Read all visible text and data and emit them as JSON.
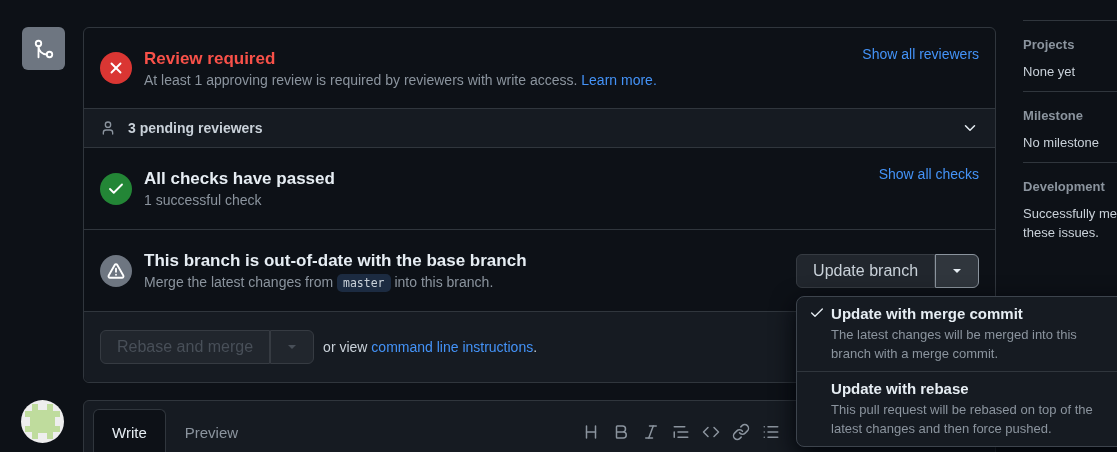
{
  "review": {
    "kind": "failure",
    "title": "Review required",
    "description": "At least 1 approving review is required by reviewers with write access.",
    "link": "Learn more.",
    "action": "Show all reviewers"
  },
  "pending": {
    "label": "3 pending reviewers",
    "expanded": false
  },
  "checks": {
    "kind": "success",
    "title": "All checks have passed",
    "description": "1 successful check",
    "action": "Show all checks"
  },
  "branch": {
    "kind": "warning",
    "title": "This branch is out-of-date with the base branch",
    "description_before": "Merge the latest changes from",
    "branch_name": "master",
    "description_after": "into this branch.",
    "button": "Update branch",
    "menu_open": true
  },
  "update_menu": [
    {
      "title": "Update with merge commit",
      "description": "The latest changes will be merged into this branch with a merge commit.",
      "selected": true
    },
    {
      "title": "Update with rebase",
      "description": "This pull request will be rebased on top of the latest changes and then force pushed.",
      "selected": false
    }
  ],
  "merge": {
    "button": "Rebase and merge",
    "disabled": true,
    "hint": "or view",
    "link": "command line instructions",
    "hint_end": "."
  },
  "comment": {
    "tabs": [
      {
        "label": "Write",
        "selected": true
      },
      {
        "label": "Preview",
        "selected": false
      }
    ]
  },
  "sidebar": [
    {
      "heading": "Projects",
      "lines": [
        "None yet"
      ]
    },
    {
      "heading": "Milestone",
      "lines": [
        "No milestone"
      ]
    },
    {
      "heading": "Development",
      "lines": [
        "Successfully me",
        "these issues."
      ]
    }
  ]
}
